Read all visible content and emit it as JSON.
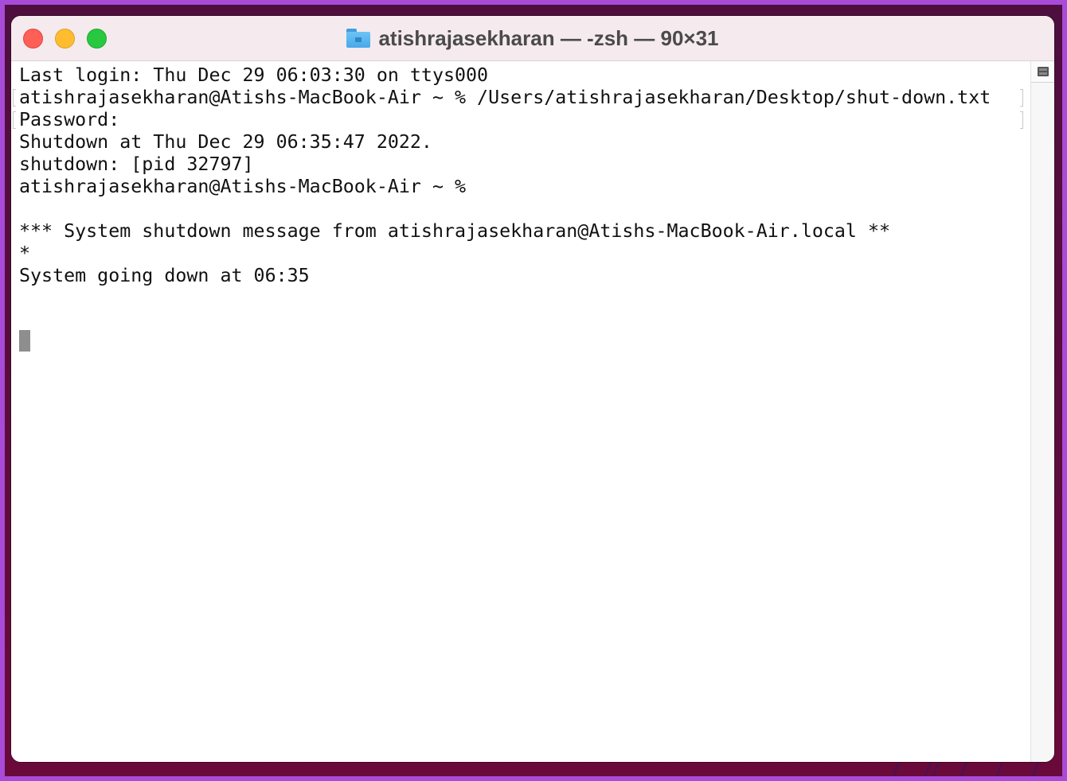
{
  "window": {
    "title": "atishrajasekharan — -zsh — 90×31",
    "title_icon": "home-folder-icon",
    "controls": {
      "close": "close-button",
      "minimize": "minimize-button",
      "maximize": "zoom-button"
    },
    "colors": {
      "close": "#fe5f57",
      "minimize": "#febc2e",
      "maximize": "#28c840",
      "desktop_background": "#5a0c3c",
      "desktop_border": "#a84bd8"
    }
  },
  "terminal": {
    "lines": [
      {
        "text": "Last login: Thu Dec 29 06:03:30 on ttys000",
        "marked": false
      },
      {
        "text": "atishrajasekharan@Atishs-MacBook-Air ~ % /Users/atishrajasekharan/Desktop/shut-down.txt",
        "marked": true
      },
      {
        "text": "Password:",
        "marked": true
      },
      {
        "text": "Shutdown at Thu Dec 29 06:35:47 2022.",
        "marked": false
      },
      {
        "text": "shutdown: [pid 32797]",
        "marked": false
      },
      {
        "text": "atishrajasekharan@Atishs-MacBook-Air ~ %",
        "marked": false
      },
      {
        "text": "",
        "marked": false
      },
      {
        "text": "*** System shutdown message from atishrajasekharan@Atishs-MacBook-Air.local **",
        "marked": false
      },
      {
        "text": "*",
        "marked": false
      },
      {
        "text": "System going down at 06:35",
        "marked": false
      }
    ],
    "cursor": "block-cursor",
    "split_pane_icon": "split-pane-icon"
  }
}
